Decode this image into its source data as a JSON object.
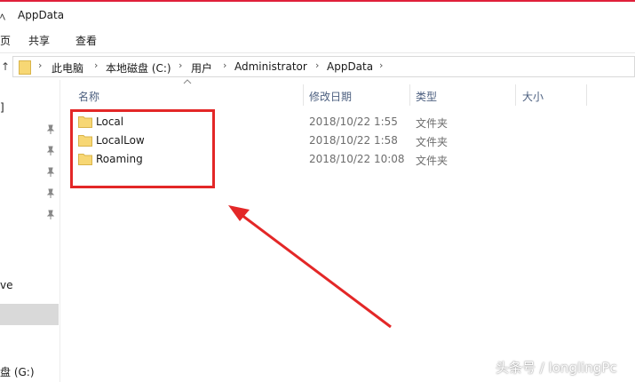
{
  "window": {
    "title_glyph": "ﾍ",
    "title": "AppData"
  },
  "ribbon": {
    "tabs": [
      "页",
      "共享",
      "查看"
    ]
  },
  "addressbar": {
    "up_glyph": "↑",
    "crumbs": [
      "此电脑",
      "本地磁盘 (C:)",
      "用户",
      "Administrator",
      "AppData"
    ],
    "separator": "›",
    "dropdown": "⌄"
  },
  "nav": {
    "item_top": "]",
    "item_drive": "ve",
    "item_g": "盘 (G:)"
  },
  "header": {
    "name": "名称",
    "date": "修改日期",
    "type": "类型",
    "size": "大小"
  },
  "files": [
    {
      "name": "Local",
      "date": "2018/10/22 1:55",
      "type": "文件夹"
    },
    {
      "name": "LocalLow",
      "date": "2018/10/22 1:58",
      "type": "文件夹"
    },
    {
      "name": "Roaming",
      "date": "2018/10/22 10:08",
      "type": "文件夹"
    }
  ],
  "colors": {
    "annotation": "#e32727",
    "folder": "#f7d774",
    "folder_edge": "#d9b44a",
    "title_accent": "#e0203a"
  },
  "watermark": "头条号 / longlingPc"
}
